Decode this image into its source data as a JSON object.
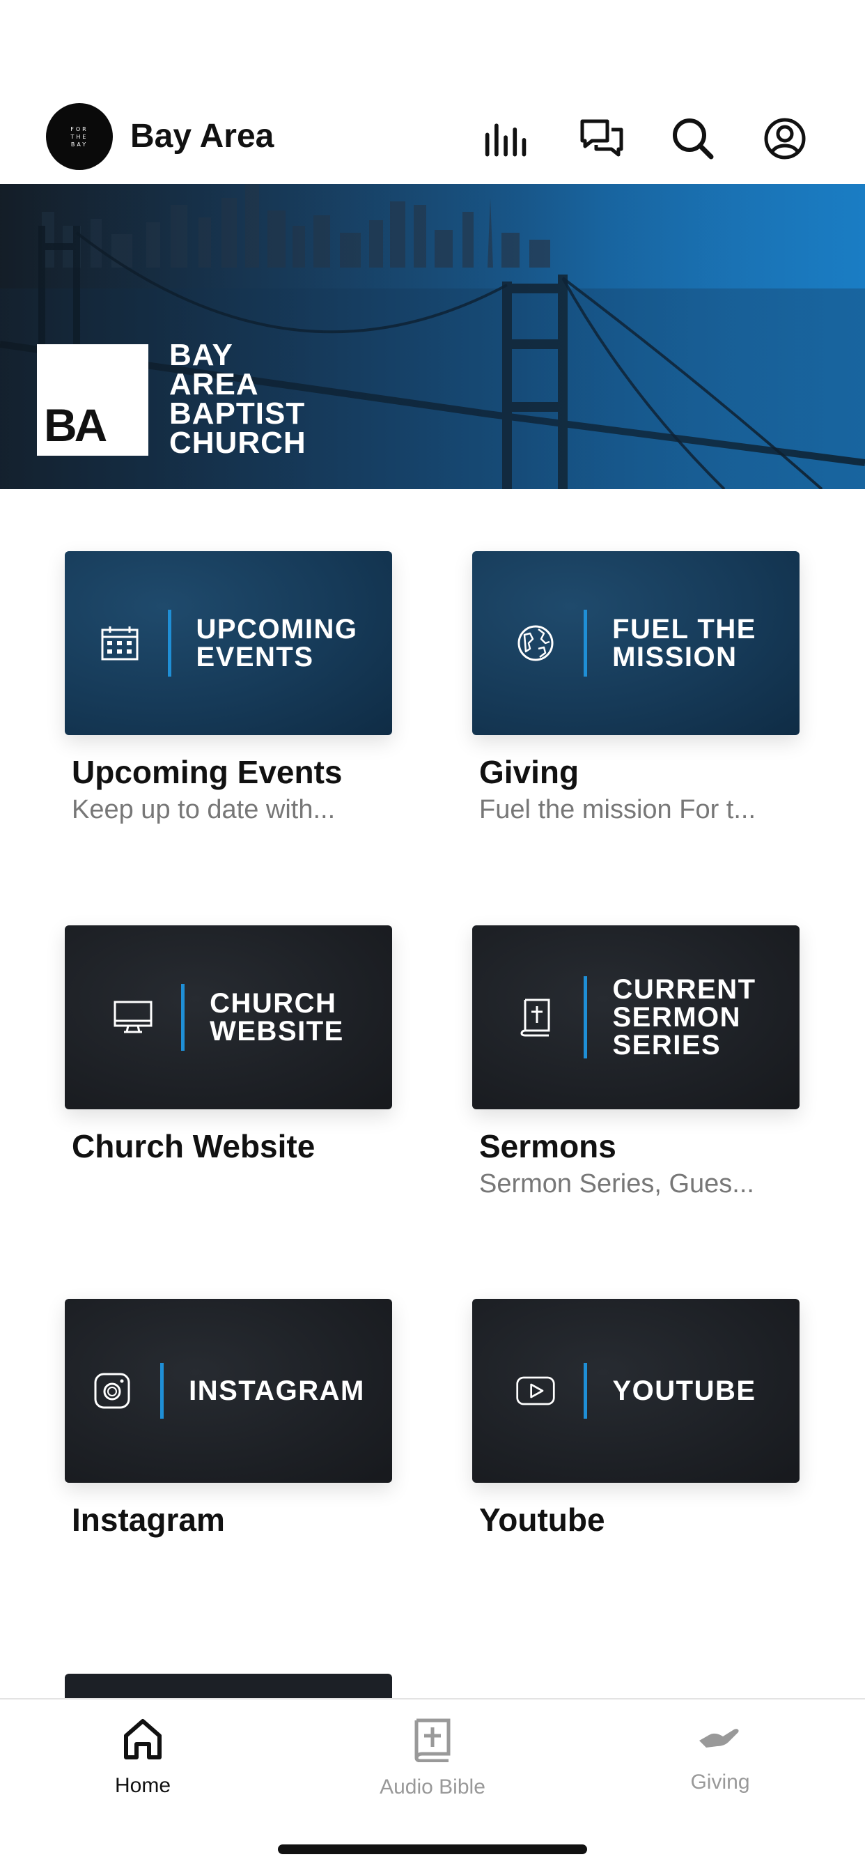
{
  "header": {
    "logo_lines": [
      "FOR",
      "THE",
      "BAY"
    ],
    "title": "Bay Area",
    "icons": [
      "audio-bars-icon",
      "chat-icon",
      "search-icon",
      "profile-icon"
    ]
  },
  "hero": {
    "logo_mark": "BA",
    "church_name_lines": [
      "BAY",
      "AREA",
      "BAPTIST",
      "CHURCH"
    ]
  },
  "tiles": [
    {
      "card_lines": [
        "UPCOMING",
        "EVENTS"
      ],
      "icon": "calendar-icon",
      "title": "Upcoming Events",
      "subtitle": "Keep up to date with...",
      "style": "blue"
    },
    {
      "card_lines": [
        "FUEL THE",
        "MISSION"
      ],
      "icon": "globe-icon",
      "title": "Giving",
      "subtitle": "Fuel the mission For t...",
      "style": "blue"
    },
    {
      "card_lines": [
        "CHURCH",
        "WEBSITE"
      ],
      "icon": "monitor-icon",
      "title": "Church Website",
      "subtitle": "",
      "style": "dark"
    },
    {
      "card_lines": [
        "CURRENT",
        "SERMON",
        "SERIES"
      ],
      "icon": "bible-icon",
      "title": "Sermons",
      "subtitle": "Sermon Series, Gues...",
      "style": "dark"
    },
    {
      "card_lines": [
        "INSTAGRAM"
      ],
      "icon": "instagram-icon",
      "title": "Instagram",
      "subtitle": "",
      "style": "dark"
    },
    {
      "card_lines": [
        "YOUTUBE"
      ],
      "icon": "youtube-icon",
      "title": "Youtube",
      "subtitle": "",
      "style": "dark"
    }
  ],
  "tabbar": {
    "tabs": [
      {
        "label": "Home",
        "icon": "home-icon",
        "active": true
      },
      {
        "label": "Audio Bible",
        "icon": "bible-plus-icon",
        "active": false
      },
      {
        "label": "Giving",
        "icon": "giving-hand-icon",
        "active": false
      }
    ]
  },
  "colors": {
    "accent_blue": "#1f8fd6",
    "card_blue": "#163a58",
    "card_dark": "#1d2025",
    "text_dark": "#111111",
    "text_muted": "#777777"
  }
}
